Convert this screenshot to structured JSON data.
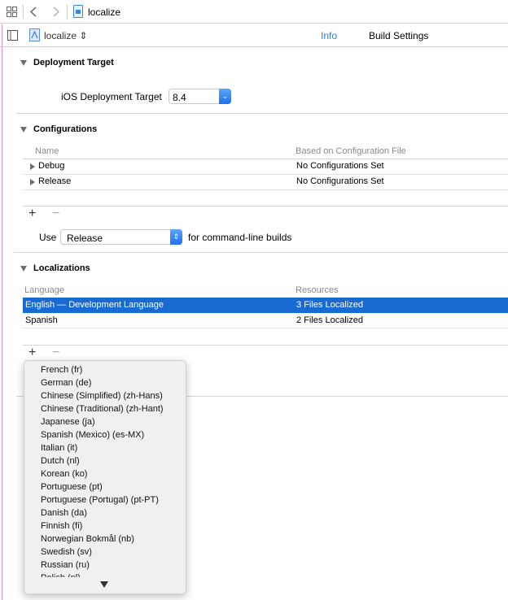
{
  "toolbar": {
    "breadcrumb": "localize",
    "icons": [
      "grid-icon",
      "back-chevron-icon",
      "forward-chevron-icon",
      "file-icon"
    ]
  },
  "tabbar": {
    "target": "localize",
    "tabs": [
      {
        "label": "Info",
        "active": true
      },
      {
        "label": "Build Settings",
        "active": false
      }
    ]
  },
  "deployment": {
    "title": "Deployment Target",
    "label": "iOS Deployment Target",
    "value": "8.4"
  },
  "configurations": {
    "title": "Configurations",
    "columns": [
      "Name",
      "Based on Configuration File"
    ],
    "rows": [
      {
        "name": "Debug",
        "file": "No Configurations Set"
      },
      {
        "name": "Release",
        "file": "No Configurations Set"
      }
    ],
    "use_label": "Use",
    "use_value": "Release",
    "use_suffix": "for command-line builds",
    "add": "+",
    "remove": "−"
  },
  "localizations": {
    "title": "Localizations",
    "columns": [
      "Language",
      "Resources"
    ],
    "rows": [
      {
        "language": "English — Development Language",
        "resources": "3 Files Localized",
        "selected": true
      },
      {
        "language": "Spanish",
        "resources": "2 Files Localized",
        "selected": false
      }
    ],
    "add": "+",
    "remove": "−"
  },
  "menu": {
    "items": [
      "French (fr)",
      "German (de)",
      "Chinese (Simplified) (zh-Hans)",
      "Chinese (Traditional) (zh-Hant)",
      "Japanese (ja)",
      "Spanish (Mexico) (es-MX)",
      "Italian (it)",
      "Dutch (nl)",
      "Korean (ko)",
      "Portuguese (pt)",
      "Portuguese (Portugal) (pt-PT)",
      "Danish (da)",
      "Finnish (fi)",
      "Norwegian Bokmål (nb)",
      "Swedish (sv)",
      "Russian (ru)",
      "Polish (pl)"
    ]
  },
  "colors": {
    "accent": "#1a6ad4",
    "popup_button": "#2f86f6"
  }
}
